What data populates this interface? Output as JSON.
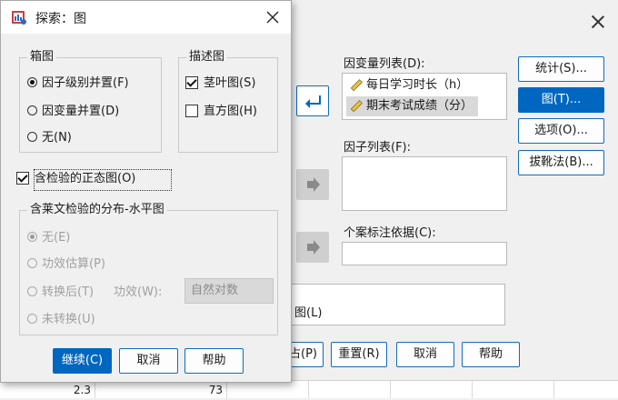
{
  "background_sheet": {
    "cells": [
      "2.3",
      "73"
    ]
  },
  "main_dialog": {
    "dependent_list_label": "因变量列表(D):",
    "dependent_items": [
      "每日学习时长（h）",
      "期末考试成绩（分）"
    ],
    "factor_list_label": "因子列表(F):",
    "case_label": "个案标注依据(C):",
    "plots_partial": "图(L)",
    "buttons": {
      "statistics": "统计(S)...",
      "plots": "图(T)...",
      "options": "选项(O)...",
      "bootstrap": "拔靴法(B)...",
      "paste_partial": "占(P)",
      "reset": "重置(R)",
      "cancel": "取消",
      "help": "帮助"
    }
  },
  "explore_plots_dialog": {
    "title": "探索：图",
    "boxplots": {
      "title": "箱图",
      "options": [
        {
          "label": "因子级别并置(F)",
          "selected": true
        },
        {
          "label": "因变量并置(D)",
          "selected": false
        },
        {
          "label": "无(N)",
          "selected": false
        }
      ]
    },
    "descriptive": {
      "title": "描述图",
      "options": [
        {
          "label": "茎叶图(S)",
          "checked": true
        },
        {
          "label": "直方图(H)",
          "checked": false
        }
      ]
    },
    "normality_plots": {
      "label": "含检验的正态图(O)",
      "checked": true
    },
    "spread_vs_level": {
      "title": "含莱文检验的分布-水平图",
      "options": [
        {
          "label": "无(E)",
          "selected": true
        },
        {
          "label": "功效估算(P)",
          "selected": false
        },
        {
          "label": "转换后(T)",
          "selected": false
        },
        {
          "label": "未转换(U)",
          "selected": false
        }
      ],
      "power_label": "功效(W):",
      "power_value": "自然对数"
    },
    "buttons": {
      "continue": "继续(C)",
      "cancel": "取消",
      "help": "帮助"
    }
  },
  "colors": {
    "accent": "#0067c0",
    "dialog_bg": "#f0f0f0",
    "disabled_text": "#a0a0a0"
  }
}
